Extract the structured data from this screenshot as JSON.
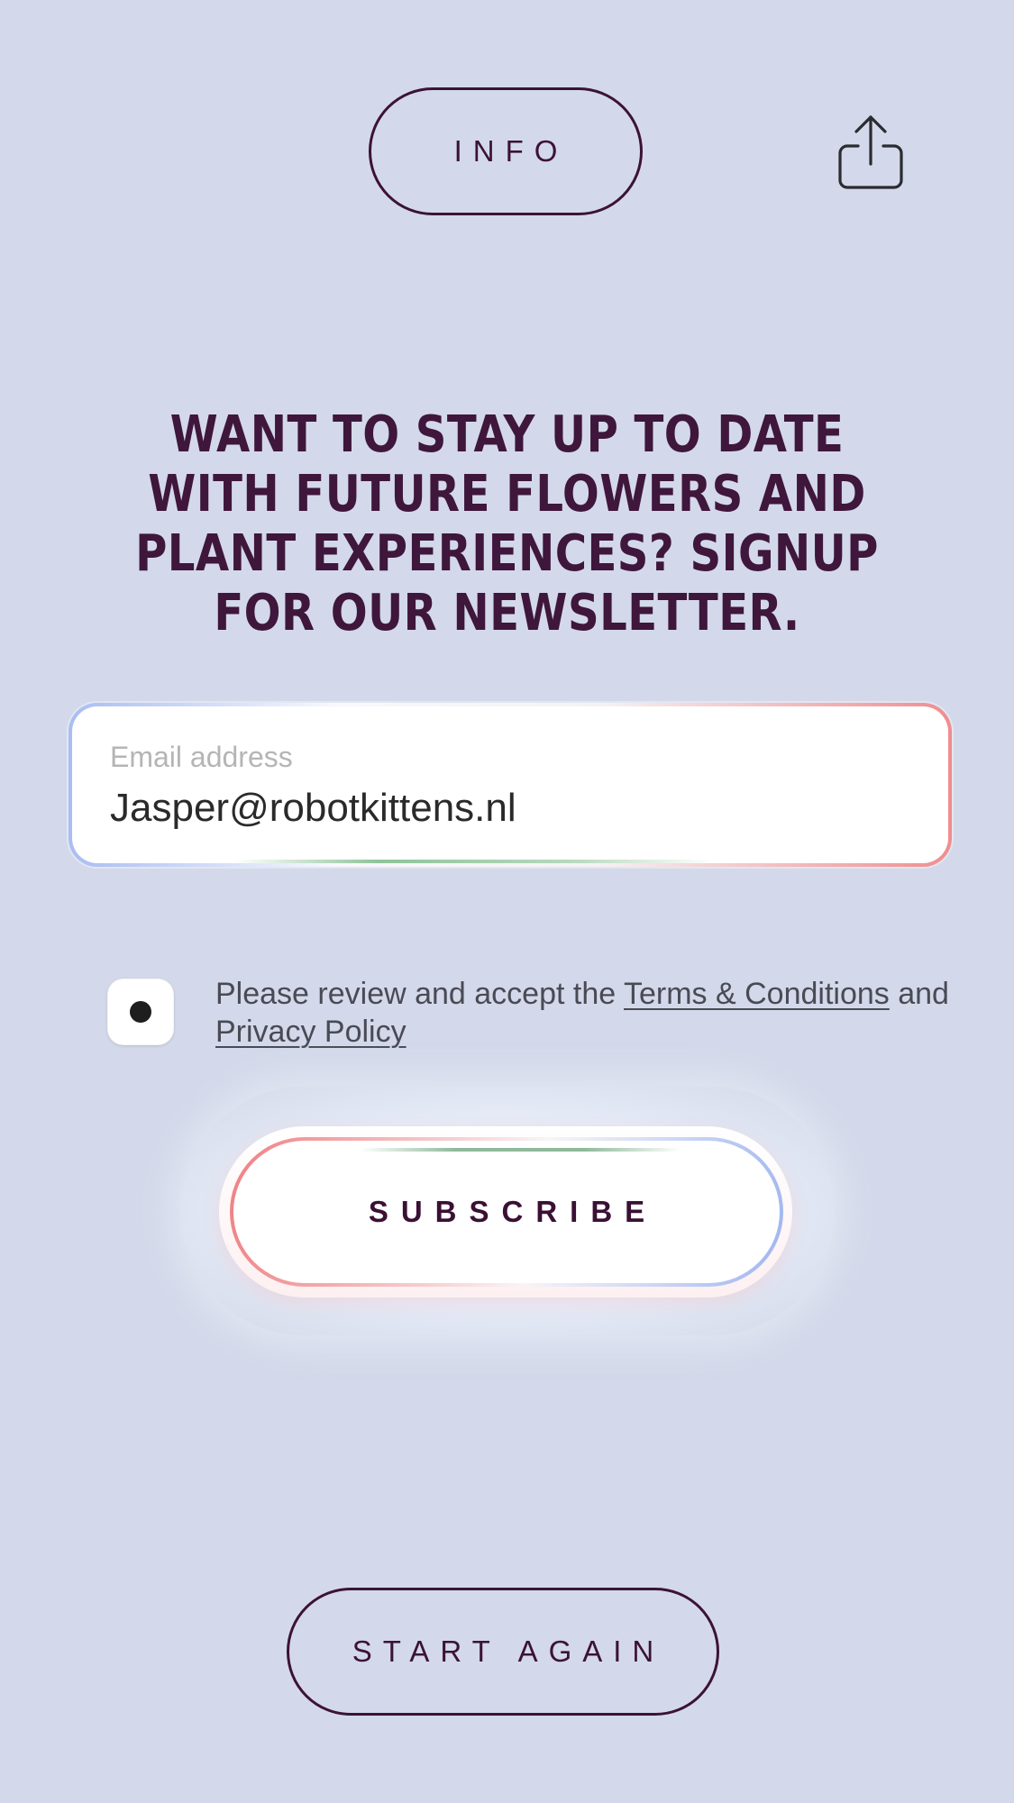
{
  "header": {
    "info_label": "INFO",
    "share_icon": "share-upload-icon"
  },
  "headline": {
    "text": "WANT TO STAY UP TO DATE WITH FUTURE FLOWERS AND PLANT EXPERIENCES? SIGNUP FOR OUR NEWSLETTER."
  },
  "email": {
    "label": "Email address",
    "value": "Jasper@robotkittens.nl"
  },
  "consent": {
    "checked": true,
    "text_before": "Please review and accept the ",
    "terms_link": "Terms & Conditions",
    "text_middle": " and ",
    "privacy_link": "Privacy Policy"
  },
  "subscribe": {
    "label": "SUBSCRIBE"
  },
  "footer": {
    "start_again_label": "START AGAIN"
  },
  "colors": {
    "background": "#d3d9ea",
    "accent": "#3f163c",
    "text_muted": "#4a4a55",
    "placeholder": "#b5b5b5"
  }
}
